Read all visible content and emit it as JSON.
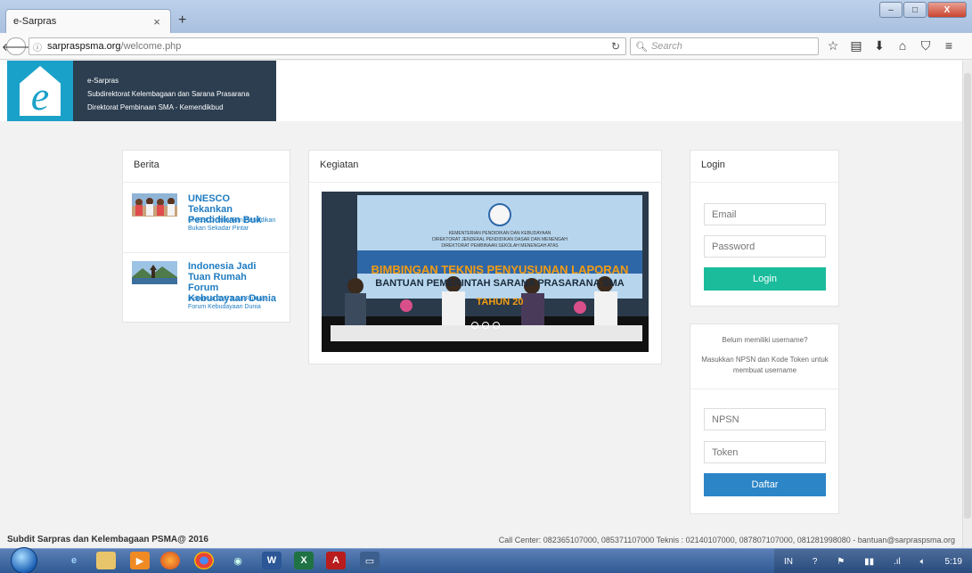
{
  "browser": {
    "tab_title": "e-Sarpras",
    "tab_close": "×",
    "new_tab": "+",
    "url_host": "sarpraspsma.org",
    "url_path": "/welcome.php",
    "search_placeholder": "Search",
    "window_buttons": {
      "minimize": "–",
      "maximize": "□",
      "close": "X"
    }
  },
  "header": {
    "logo_letter": "e",
    "app_name": "e-Sarpras",
    "line2": "Subdirektorat Kelembagaan dan Sarana Prasarana",
    "line3": "Direktorat Pembinaan SMA - Kemendikbud"
  },
  "berita": {
    "title": "Berita",
    "items": [
      {
        "title": "UNESCO Tekankan Pendidikan Buk",
        "summary": "UNESCO Tekankan Pendidikan Bukan Sekadar Pintar"
      },
      {
        "title": "Indonesia Jadi Tuan Rumah Forum Kebudayaan Dunia",
        "summary": "Indonesia Jadi Tuan Rumah Forum Kebudayaan Dunia"
      }
    ]
  },
  "kegiatan": {
    "title": "Kegiatan",
    "banner_line1": "KEMENTERIAN PENDIDIKAN DAN KEBUDAYAAN",
    "banner_line2": "DIREKTORAT JENDERAL PENDIDIKAN DASAR DAN MENENGAH",
    "banner_line3": "DIREKTORAT PEMBINAAN SEKOLAH MENENGAH ATAS",
    "banner_headline": "BIMBINGAN TEKNIS PENYUSUNAN LAPORAN",
    "banner_sub": "BANTUAN PEMERINTAH SARANA PRASARANA SMA",
    "banner_year": "TAHUN 20"
  },
  "login": {
    "title": "Login",
    "email_placeholder": "Email",
    "password_placeholder": "Password",
    "button": "Login"
  },
  "register": {
    "note1": "Belum memiliki username?",
    "note2": "Masukkan NPSN dan Kode Token untuk membuat username",
    "npsn_placeholder": "NPSN",
    "token_placeholder": "Token",
    "button": "Daftar"
  },
  "footer": {
    "left": "Subdit Sarpras dan Kelembagaan PSMA@ 2016",
    "right": "Call Center: 082365107000, 085371107000 Teknis : 02140107000, 087807107000, 081281998080 - bantuan@sarpraspsma.org"
  },
  "taskbar": {
    "lang": "IN",
    "clock": "5:19"
  },
  "colors": {
    "header_dark": "#2c3e50",
    "logo_blue": "#1aa1c9",
    "login_green": "#1abc9c",
    "daftar_blue": "#2b85c7",
    "link_blue": "#1f7cc2"
  }
}
